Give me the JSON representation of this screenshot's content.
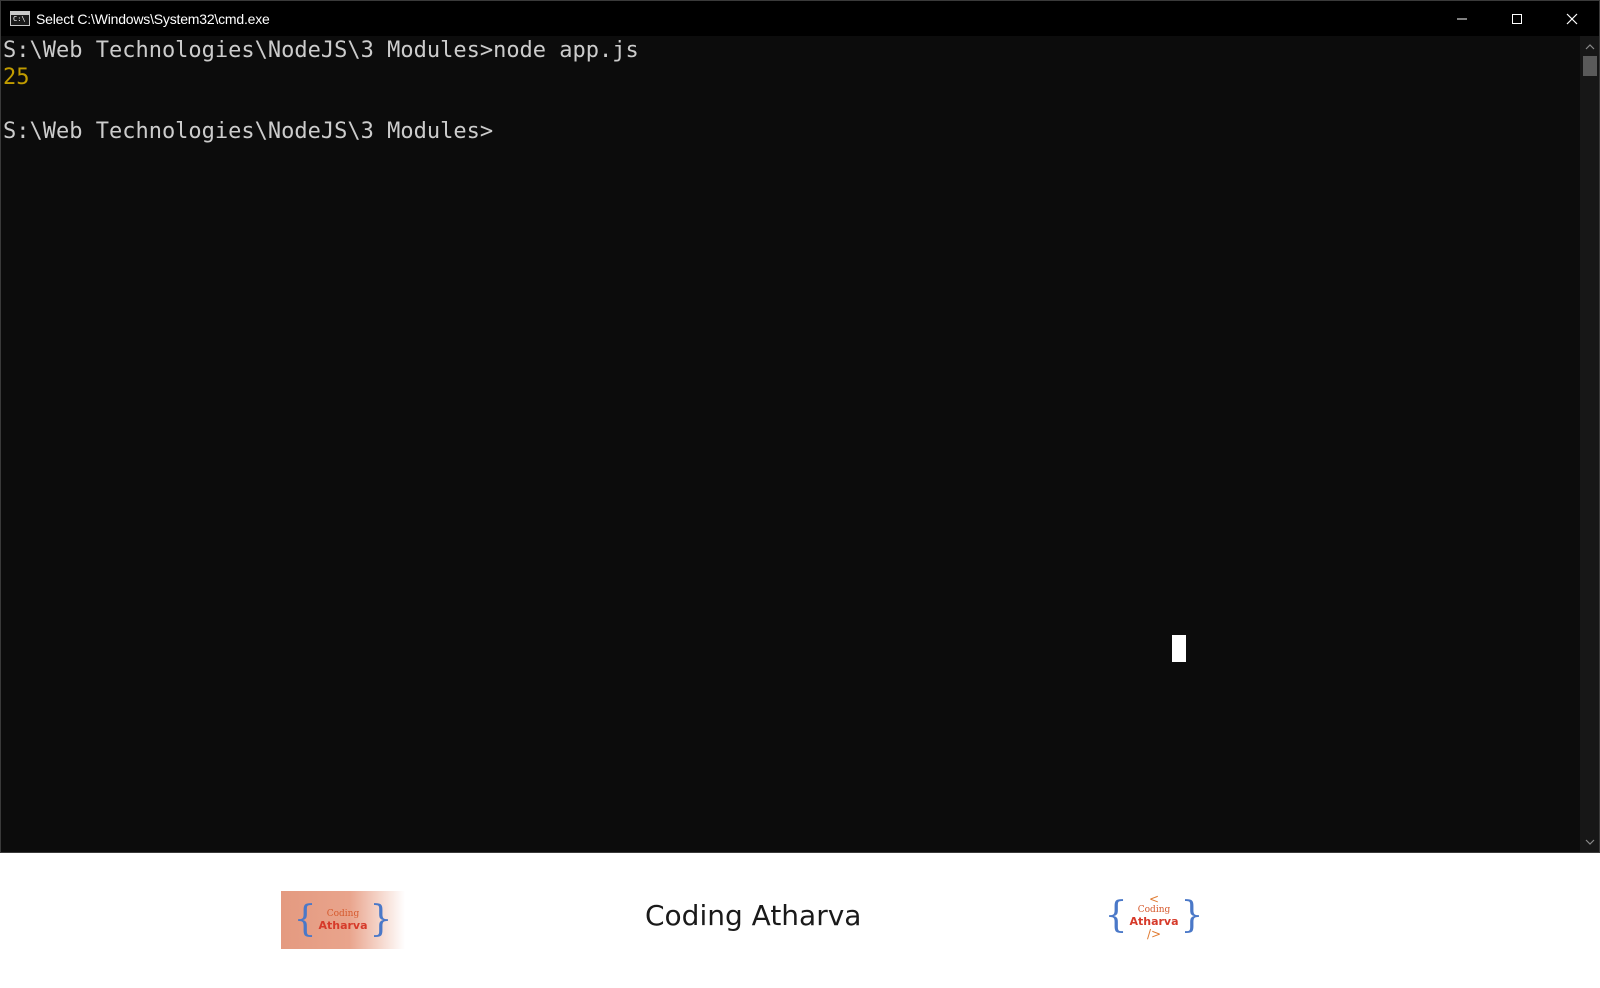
{
  "window": {
    "title": "Select C:\\Windows\\System32\\cmd.exe",
    "icon_label": "C:\\",
    "controls": [
      "minimize-icon",
      "maximize-icon",
      "close-icon"
    ]
  },
  "console": {
    "lines": [
      {
        "text": "S:\\Web Technologies\\NodeJS\\3 Modules>node app.js",
        "kind": "prompt"
      },
      {
        "text": "25",
        "kind": "output"
      },
      {
        "text": "",
        "kind": "blank"
      },
      {
        "text": "S:\\Web Technologies\\NodeJS\\3 Modules>",
        "kind": "prompt"
      }
    ]
  },
  "footer": {
    "title": "Coding Atharva",
    "logo_small": "Coding",
    "logo_main": "Atharva",
    "logo_open": "<",
    "logo_close": "/>",
    "brace_open": "{",
    "brace_close": "}"
  },
  "colors": {
    "console_bg": "#0c0c0c",
    "console_text": "#cccccc",
    "output_text": "#c19c00",
    "brace": "#4a78c8",
    "logo_text": "#d63a2a"
  }
}
